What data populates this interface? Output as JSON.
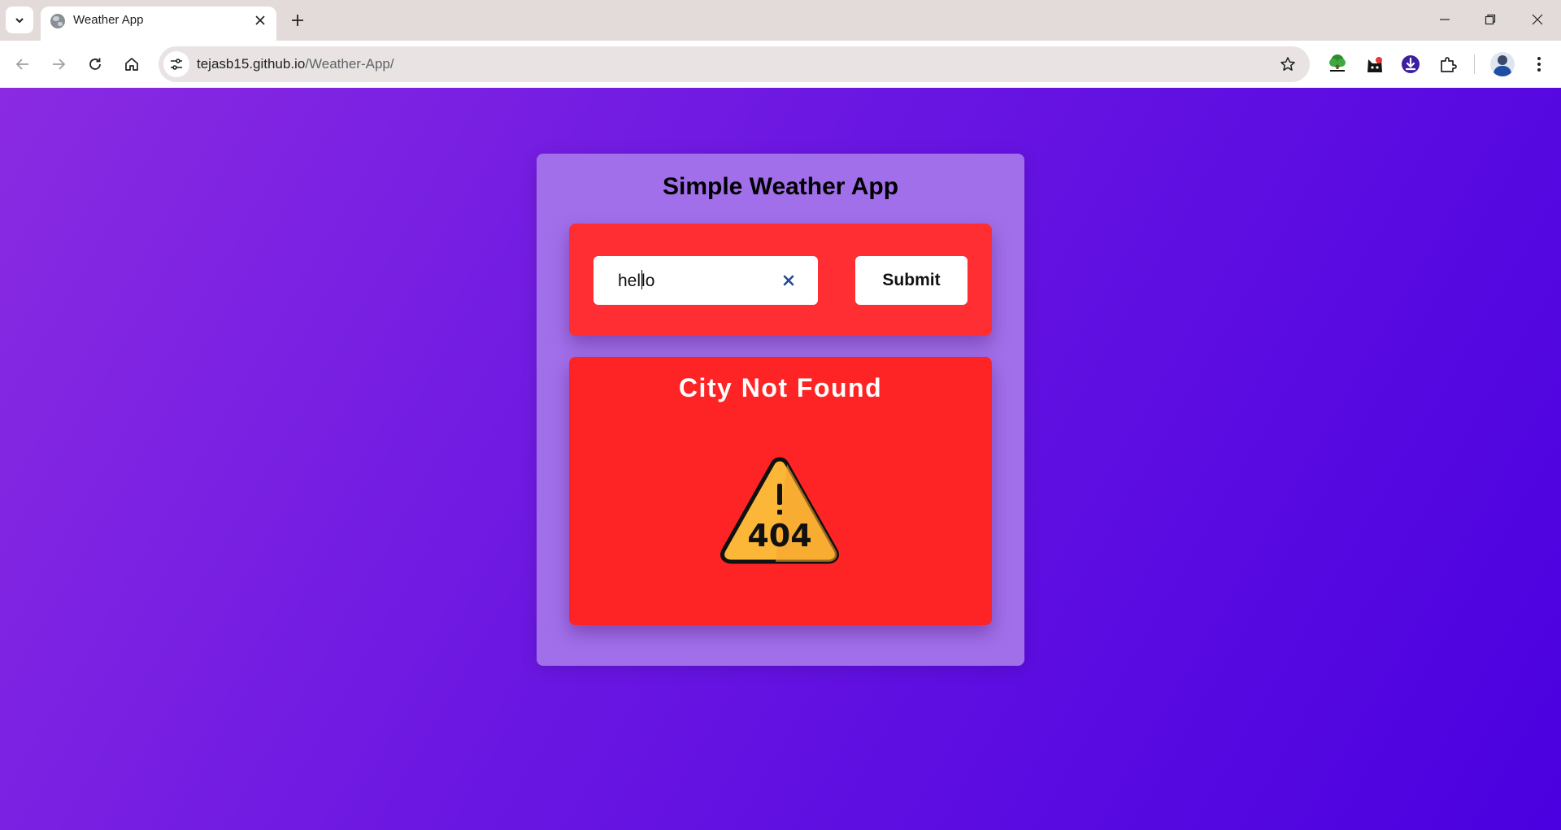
{
  "browser": {
    "tab": {
      "title": "Weather App"
    },
    "address": {
      "host": "tejasb15.github.io",
      "path": "/Weather-App/"
    },
    "extensions": [
      {
        "name": "html-tree-extension-icon"
      },
      {
        "name": "dark-cat-extension-icon"
      },
      {
        "name": "download-extension-icon"
      },
      {
        "name": "puzzle-extensions-icon"
      }
    ]
  },
  "page": {
    "title": "Simple Weather App",
    "search": {
      "value": "hello",
      "value_before_caret": "hel",
      "value_after_caret": "lo",
      "submit_label": "Submit"
    },
    "result": {
      "title": "City Not Found",
      "icon": "warning-404-icon",
      "icon_text": "404"
    }
  },
  "colors": {
    "background_start": "#8a2be2",
    "background_end": "#4a00e0",
    "card": "#a16fea",
    "panel": "#fe2e32",
    "warning_fill": "#fcb638"
  }
}
